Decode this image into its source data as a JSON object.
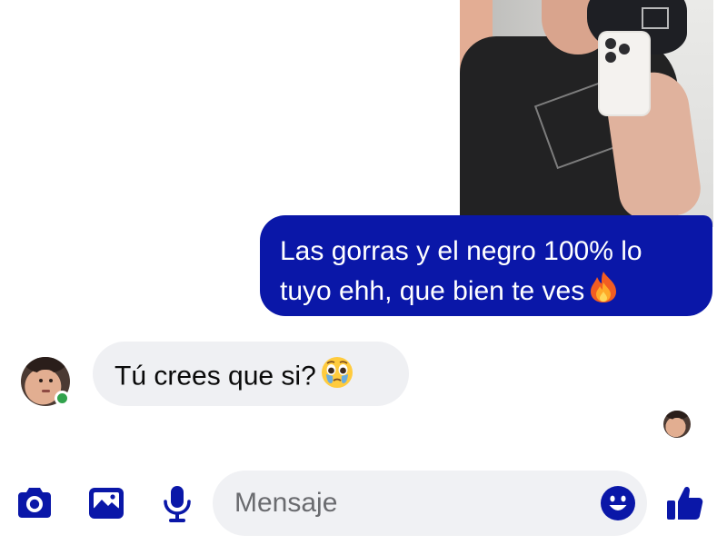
{
  "conversation": {
    "messages": [
      {
        "direction": "outgoing",
        "type": "photo",
        "description": "mirror selfie"
      },
      {
        "direction": "outgoing",
        "type": "text",
        "line1": "Las gorras y el negro 100% lo",
        "line2": "tuyo ehh, que bien te ves",
        "emoji": "🔥"
      },
      {
        "direction": "incoming",
        "type": "text",
        "text": "Tú crees que si?",
        "emoji": "🥹"
      }
    ],
    "contact": {
      "status": "online"
    },
    "read_receipt": "seen"
  },
  "composer": {
    "placeholder": "Mensaje",
    "value": "",
    "camera_icon": "camera-icon",
    "gallery_icon": "image-icon",
    "mic_icon": "microphone-icon",
    "emoji_icon": "smiley-icon",
    "like_icon": "thumbs-up-icon"
  },
  "colors": {
    "accent": "#0a17a8",
    "incoming_bubble": "#eff0f3",
    "online": "#31a24c"
  }
}
